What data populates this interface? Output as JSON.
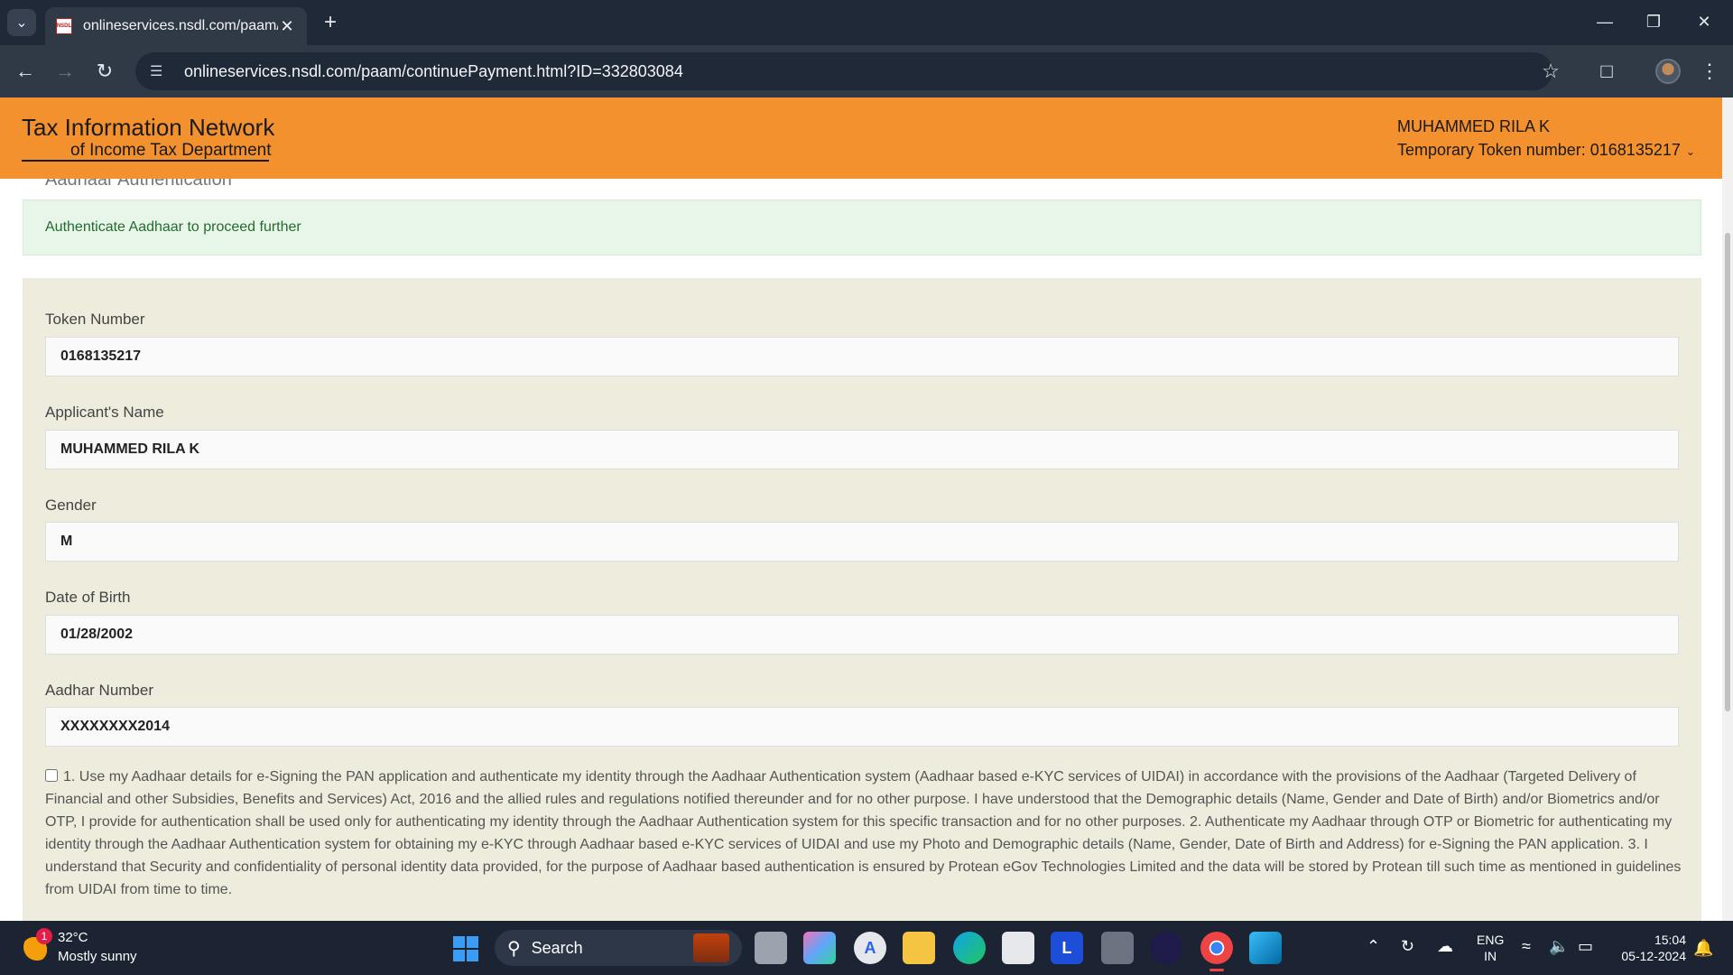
{
  "browser": {
    "tab_title": "onlineservices.nsdl.com/paam/c",
    "favicon_text": "NSDL",
    "url": "onlineservices.nsdl.com/paam/continuePayment.html?ID=332803084"
  },
  "header": {
    "logo_line1": "Tax Information Network",
    "logo_line2": "of Income Tax Department",
    "user_name": "MUHAMMED RILA K",
    "token_text": "Temporary Token number: 0168135217"
  },
  "section_heading": "Aadhaar Authentication",
  "alert": {
    "message": "Authenticate Aadhaar to proceed further"
  },
  "form": {
    "fields": [
      {
        "label": "Token Number",
        "value": "0168135217"
      },
      {
        "label": "Applicant's Name",
        "value": "MUHAMMED RILA K"
      },
      {
        "label": "Gender",
        "value": "M"
      },
      {
        "label": "Date of Birth",
        "value": "01/28/2002"
      },
      {
        "label": "Aadhar Number",
        "value": "XXXXXXXX2014"
      }
    ],
    "consent_text": "1. Use my Aadhaar details for e-Signing the PAN application and authenticate my identity through the Aadhaar Authentication system (Aadhaar based e-KYC services of UIDAI) in accordance with the provisions of the Aadhaar (Targeted Delivery of Financial and other Subsidies, Benefits and Services) Act, 2016 and the allied rules and regulations notified thereunder and for no other purpose. I have understood that the Demographic details (Name, Gender and Date of Birth) and/or Biometrics and/or OTP, I provide for authentication shall be used only for authenticating my identity through the Aadhaar Authentication system for this specific transaction and for no other purposes. 2. Authenticate my Aadhaar through OTP or Biometric for authenticating my identity through the Aadhaar Authentication system for obtaining my e-KYC through Aadhaar based e-KYC services of UIDAI and use my Photo and Demographic details (Name, Gender, Date of Birth and Address) for e-Signing the PAN application. 3. I understand that Security and confidentiality of personal identity data provided, for the purpose of Aadhaar based authentication is ensured by Protean eGov Technologies Limited and the data will be stored by Protean till such time as mentioned in guidelines from UIDAI from time to time."
  },
  "taskbar": {
    "weather_badge": "1",
    "temperature": "32°C",
    "condition": "Mostly sunny",
    "search_label": "Search",
    "lang_line1": "ENG",
    "lang_line2": "IN",
    "time": "15:04",
    "date": "05-12-2024"
  },
  "colors": {
    "header_bg": "#f4912f",
    "alert_bg": "#e8f5e9",
    "panel_bg": "#eeecdd"
  }
}
